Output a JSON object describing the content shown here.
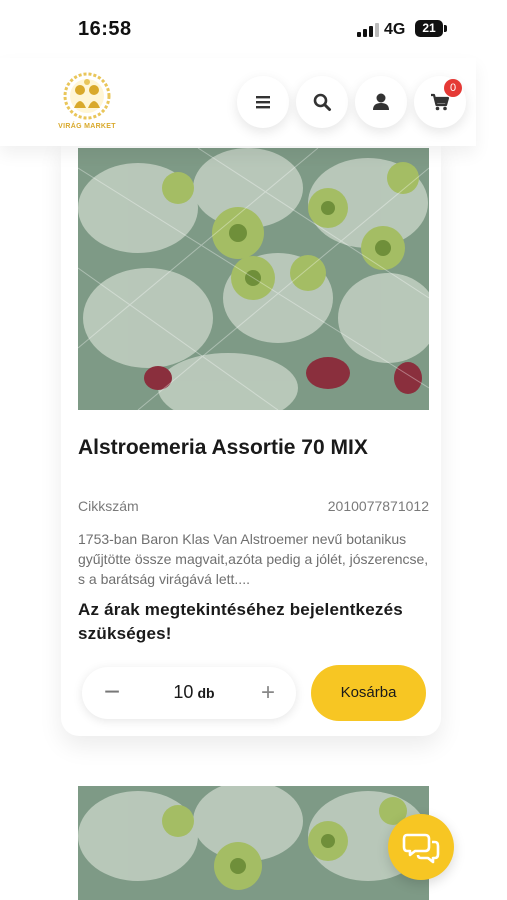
{
  "status": {
    "time": "16:58",
    "network": "4G",
    "battery": "21"
  },
  "header": {
    "logo_text": "VIRÁG MARKET",
    "cart_count": "0"
  },
  "product": {
    "title": "Alstroemeria Assortie 70 MIX",
    "sku_label": "Cikkszám",
    "sku_value": "2010077871012",
    "description": "1753-ban Baron Klas Van Alstroemer nevű botanikus gyűjtötte össze magvait,azóta pedig a jólét, jószerencse, s a barátság virágává lett....",
    "login_note": "Az árak megtekintéséhez bejelentkezés szükséges!",
    "quantity": "10",
    "unit": "db",
    "add_to_cart": "Kosárba"
  },
  "colors": {
    "accent": "#f7c623",
    "badge": "#e53935"
  },
  "icons": [
    "menu-icon",
    "search-icon",
    "user-icon",
    "cart-icon",
    "chat-icon"
  ]
}
